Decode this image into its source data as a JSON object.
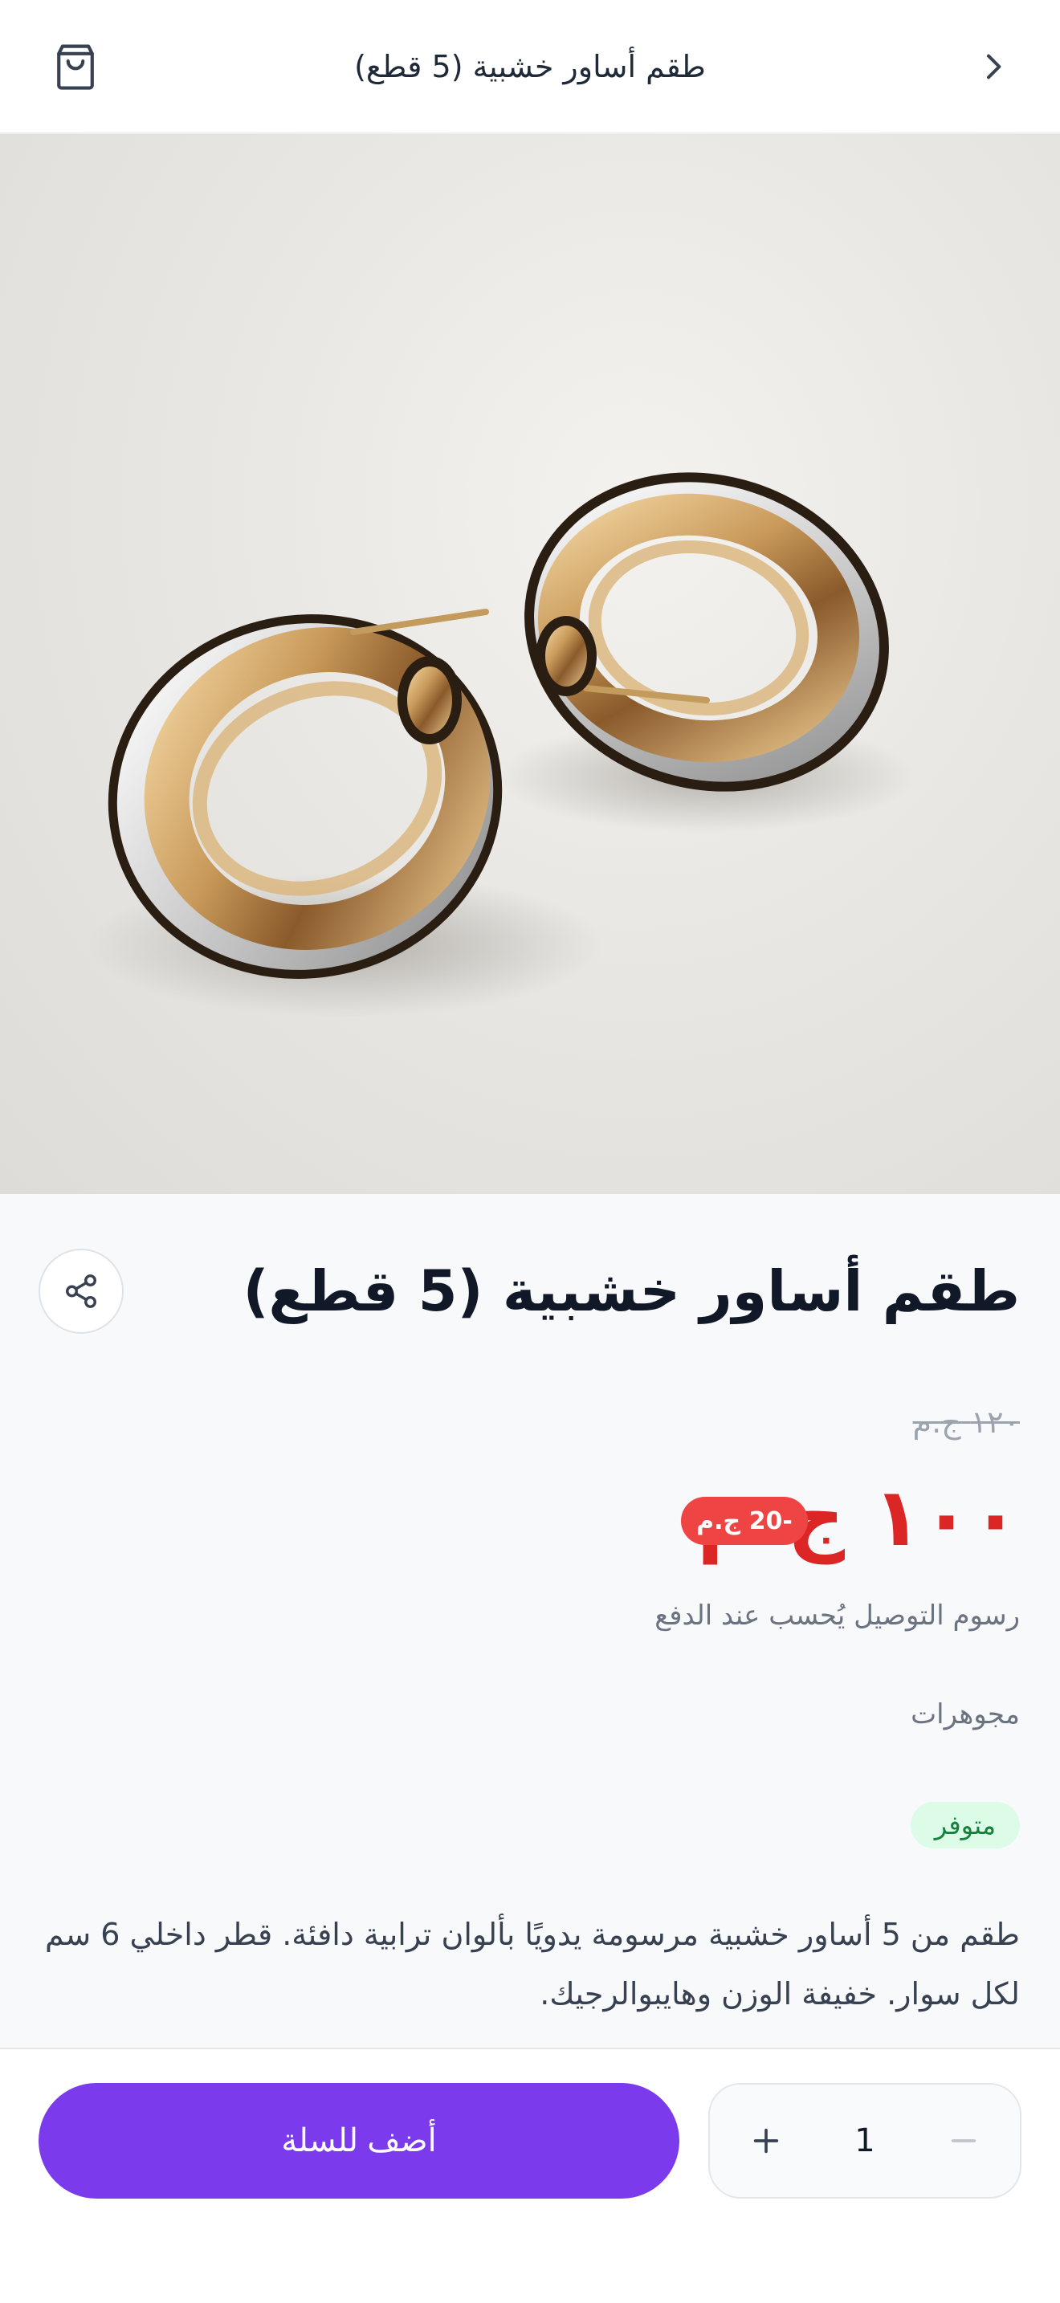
{
  "header": {
    "title": "طقم أساور خشبية (5 قطع)",
    "back_icon": "chevron-right-icon",
    "cart_icon": "shopping-bag-icon"
  },
  "product": {
    "image_alt": "earrings-photo",
    "title": "طقم أساور خشبية (5 قطع)",
    "share_icon": "share-icon",
    "old_price": "١٢٠ ج.م",
    "price": "١٠٠ ج.م",
    "discount_badge": "-20 ج.م",
    "shipping_note": "رسوم التوصيل يُحسب عند الدفع",
    "category": "مجوهرات",
    "stock_status": "متوفر",
    "description": "طقم من 5 أساور خشبية مرسومة يدويًا بألوان ترابية دافئة. قطر داخلي 6 سم لكل سوار. خفيفة الوزن وهايبوالرجيك."
  },
  "cart_bar": {
    "add_label": "أضف للسلة",
    "quantity": "1",
    "plus_icon": "plus-icon",
    "minus_icon": "minus-icon"
  },
  "colors": {
    "accent": "#7c3aed",
    "price": "#dc2626",
    "badge": "#ef4444",
    "stock_bg": "#dcfce7",
    "stock_text": "#15803d"
  }
}
